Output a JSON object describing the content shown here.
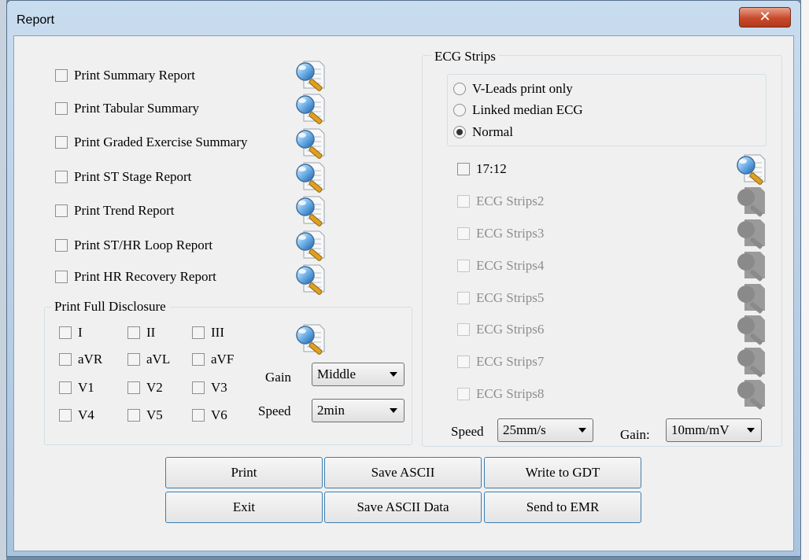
{
  "window": {
    "title": "Report",
    "close_label": "✕"
  },
  "reports": [
    {
      "label": "Print Summary Report",
      "checked": false
    },
    {
      "label": "Print Tabular Summary",
      "checked": false
    },
    {
      "label": "Print Graded Exercise Summary",
      "checked": false
    },
    {
      "label": "Print ST Stage Report",
      "checked": false
    },
    {
      "label": "Print Trend Report",
      "checked": false
    },
    {
      "label": "Print ST/HR Loop Report",
      "checked": false
    },
    {
      "label": "Print HR Recovery Report",
      "checked": false
    }
  ],
  "full_disclosure": {
    "title": "Print Full Disclosure",
    "leads": [
      "I",
      "II",
      "III",
      "aVR",
      "aVL",
      "aVF",
      "V1",
      "V2",
      "V3",
      "V4",
      "V5",
      "V6"
    ],
    "gain_label": "Gain",
    "gain_value": "Middle",
    "speed_label": "Speed",
    "speed_value": "2min"
  },
  "ecg_strips": {
    "title": "ECG Strips",
    "modes": [
      {
        "label": "V-Leads print only",
        "selected": false
      },
      {
        "label": "Linked median ECG",
        "selected": false
      },
      {
        "label": "Normal",
        "selected": true
      }
    ],
    "strips": [
      {
        "label": "17:12",
        "enabled": true
      },
      {
        "label": "ECG Strips2",
        "enabled": false
      },
      {
        "label": "ECG Strips3",
        "enabled": false
      },
      {
        "label": "ECG Strips4",
        "enabled": false
      },
      {
        "label": "ECG Strips5",
        "enabled": false
      },
      {
        "label": "ECG Strips6",
        "enabled": false
      },
      {
        "label": "ECG Strips7",
        "enabled": false
      },
      {
        "label": "ECG Strips8",
        "enabled": false
      }
    ],
    "speed_label": "Speed",
    "speed_value": "25mm/s",
    "gain_label": "Gain:",
    "gain_value": "10mm/mV"
  },
  "buttons": {
    "print": "Print",
    "save_ascii": "Save ASCII",
    "write_gdt": "Write to GDT",
    "exit": "Exit",
    "save_ascii_data": "Save ASCII Data",
    "send_emr": "Send to EMR"
  },
  "icons": {
    "preview": "magnifier-page-icon",
    "preview_disabled": "magnifier-page-disabled-icon"
  }
}
